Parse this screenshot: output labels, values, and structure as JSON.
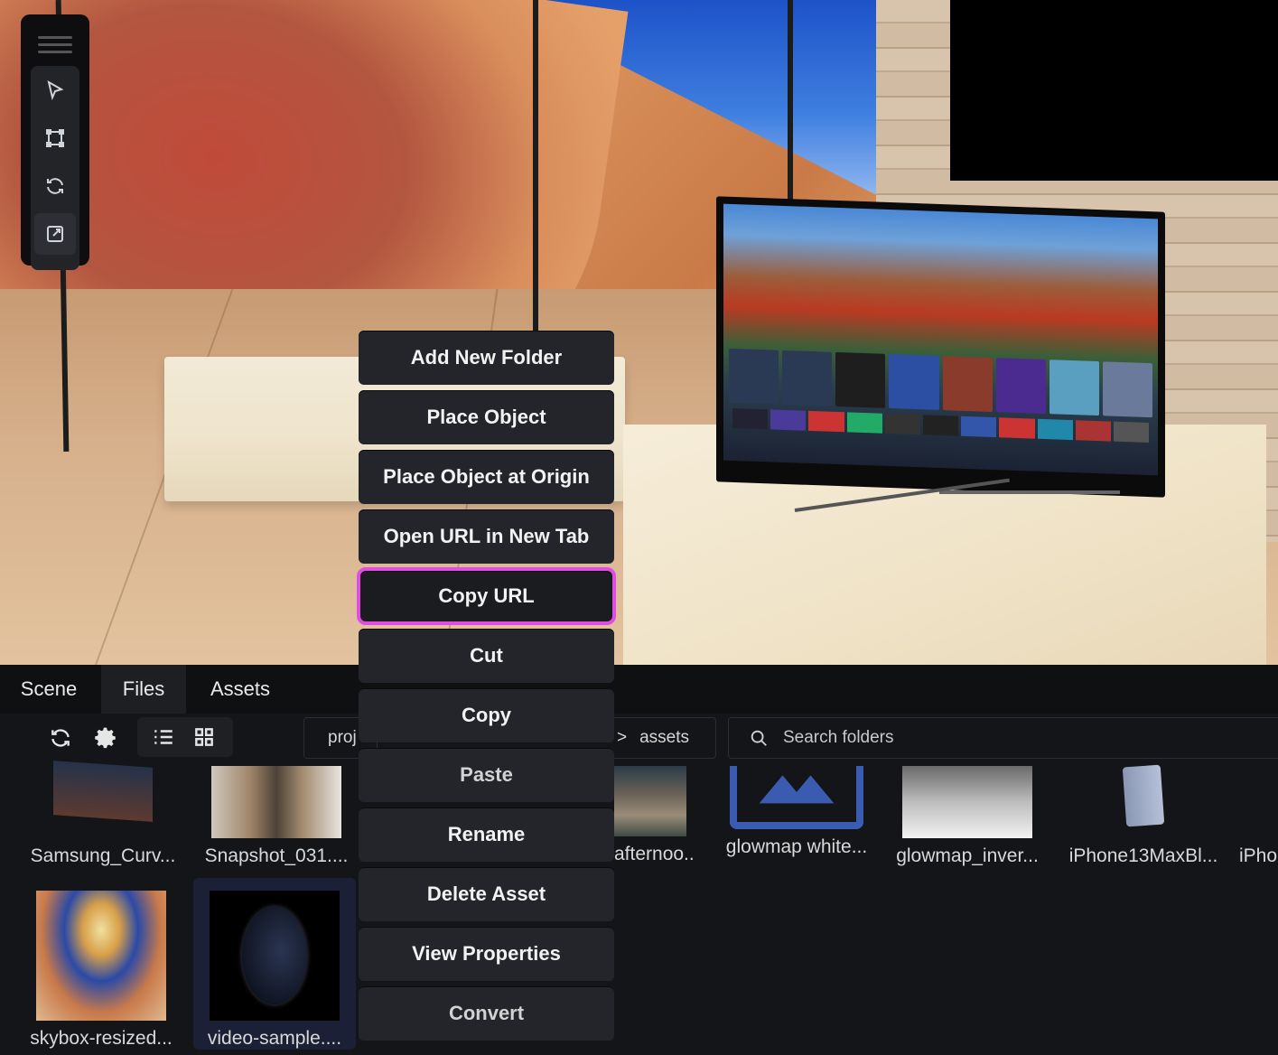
{
  "toolbar": {
    "items": [
      {
        "icon": "select-arrow-icon"
      },
      {
        "icon": "bounding-box-icon"
      },
      {
        "icon": "rotate-icon"
      },
      {
        "icon": "scale-icon"
      }
    ]
  },
  "tabs": [
    {
      "label": "Scene",
      "active": false
    },
    {
      "label": "Files",
      "active": true
    },
    {
      "label": "Assets",
      "active": false
    }
  ],
  "file_toolbar": {
    "refresh_icon": "refresh-icon",
    "settings_icon": "gear-icon",
    "list_view_icon": "list-view-icon",
    "grid_view_icon": "grid-view-icon",
    "breadcrumb_start": "proj",
    "breadcrumb_end": "assets",
    "breadcrumb_separator": ">",
    "search_placeholder": "Search folders"
  },
  "files": [
    {
      "label": "Samsung_Curv..."
    },
    {
      "label": "Snapshot_031...."
    },
    {
      "label": "afternoo.."
    },
    {
      "label": "glowmap white..."
    },
    {
      "label": "glowmap_inver..."
    },
    {
      "label": "iPhone13MaxBl..."
    },
    {
      "label": "iPho"
    },
    {
      "label": "skybox-resized..."
    },
    {
      "label": "video-sample...."
    }
  ],
  "context_menu": {
    "items": [
      {
        "label": "Add New Folder"
      },
      {
        "label": "Place Object"
      },
      {
        "label": "Place Object at Origin"
      },
      {
        "label": "Open URL in New Tab"
      },
      {
        "label": "Copy URL",
        "highlighted": true
      },
      {
        "label": "Cut"
      },
      {
        "label": "Copy"
      },
      {
        "label": "Paste"
      },
      {
        "label": "Rename"
      },
      {
        "label": "Delete Asset"
      },
      {
        "label": "View Properties"
      },
      {
        "label": "Convert"
      }
    ]
  },
  "colors": {
    "highlight": "#e14ce3",
    "menu_bg": "#24252a",
    "panel_bg": "#141518"
  }
}
